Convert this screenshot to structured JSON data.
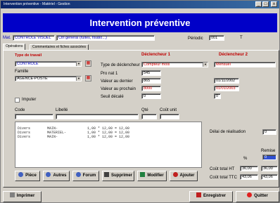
{
  "window": {
    "title": "Intervention préventive - Matériel - Gestion",
    "min": "_",
    "max": "□",
    "close": "x"
  },
  "banner": {
    "title": "Intervention préventive"
  },
  "header": {
    "code_label": "Mat.",
    "code_value": "CONTROLE VISUEL",
    "desc_value": "Ctrl général (fuites, fixatio...)",
    "period_label": "Périodic",
    "period_value": "001",
    "unit_value": "T"
  },
  "tabs": [
    {
      "label": "Opérations"
    },
    {
      "label": "Commentaires et fiches associées"
    }
  ],
  "left": {
    "travail_label": "Type de travail",
    "travail_value": "CONTROLE",
    "famille_label": "Famille",
    "famille_value": "AGENCE-POSTE",
    "imputer_label": "Imputer"
  },
  "declencheur": {
    "title1": "Déclencheur 1",
    "title2": "Déclencheur 2",
    "type_label": "Type de déclencheur",
    "type1_value": "Compteur mois",
    "type2_value": "Mensuel",
    "prochain_label": "Pro nat 1",
    "prochain_value": "545",
    "valeur_dernier_label": "Valeur au dernier",
    "valeur_dernier1": "865",
    "valeur_dernier2": "01/11/2002",
    "valeur_prochain_label": "Valeur au prochain",
    "valeur_prochain1": "8000",
    "valeur_prochain2": "01/01/2003",
    "seuil_label": "Seuil décalé",
    "seuil1": "0",
    "seuil2": "0"
  },
  "grid": {
    "col_code": "Code",
    "col_libelle": "Libellé",
    "col_qte": "Qté",
    "col_cout": "Coût unit",
    "rows": [
      "Divers        MAIN-              1,00 * 12,00 = 12,00",
      "Divers        MATERIEL-          1,00 * 12,00 = 12,00",
      "Divers        MAIN-              1,00 * 12,00 = 12,00"
    ]
  },
  "side": {
    "delai_label": "Délai de réalisation",
    "delai_value": "0",
    "remise_label": "Remise",
    "remise_value": "0",
    "pct_label": "%",
    "cout_ht_label": "Coût total HT",
    "cout_ht_value": "36,00",
    "cout_ht_value2": "36,00",
    "cout_ttc_label": "Coût total TTC",
    "cout_ttc_value": "43,06",
    "cout_ttc_value2": "43,06"
  },
  "buttons": {
    "piece": "Pièce",
    "autres": "Autres",
    "forum": "Forum",
    "supprimer": "Supprimer",
    "modifier": "Modifier",
    "ajouter": "Ajouter",
    "imprimer": "Imprimer",
    "enregistrer": "Enregistrer",
    "quitter": "Quitter"
  }
}
